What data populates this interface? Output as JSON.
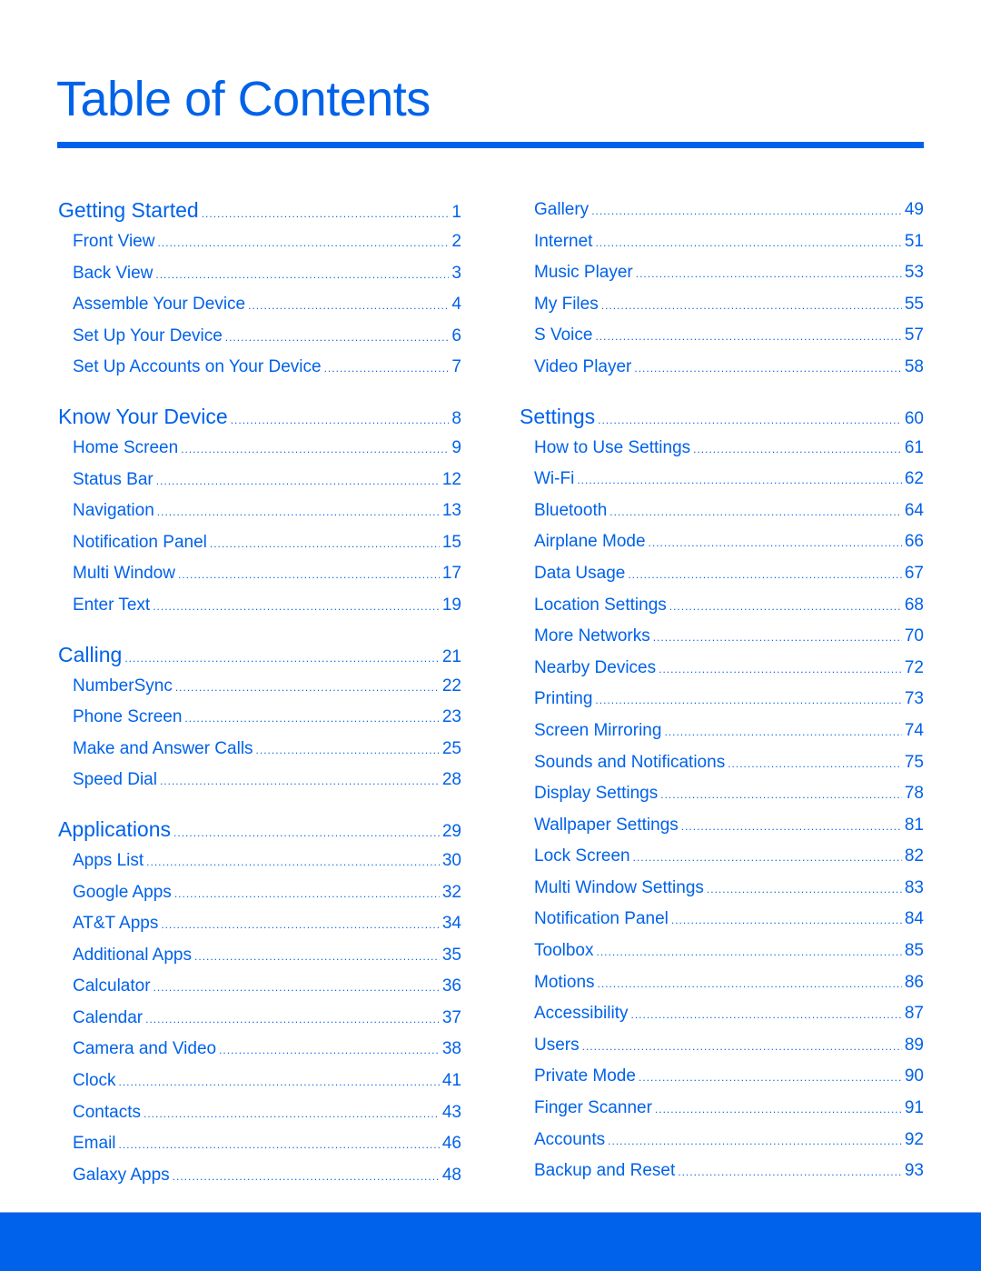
{
  "page": {
    "title": "Table of Contents",
    "accent_color": "#0062ea"
  },
  "toc": {
    "left": [
      {
        "title": "Getting Started",
        "page": "1",
        "items": [
          {
            "label": "Front View",
            "page": "2"
          },
          {
            "label": "Back View",
            "page": "3"
          },
          {
            "label": "Assemble Your Device",
            "page": "4"
          },
          {
            "label": "Set Up Your Device",
            "page": "6"
          },
          {
            "label": "Set Up Accounts on Your Device",
            "page": "7"
          }
        ]
      },
      {
        "title": "Know Your Device",
        "page": "8",
        "items": [
          {
            "label": "Home Screen",
            "page": "9"
          },
          {
            "label": "Status Bar",
            "page": "12"
          },
          {
            "label": "Navigation",
            "page": "13"
          },
          {
            "label": "Notification Panel",
            "page": "15"
          },
          {
            "label": "Multi Window",
            "page": "17"
          },
          {
            "label": "Enter Text",
            "page": "19"
          }
        ]
      },
      {
        "title": "Calling",
        "page": "21",
        "items": [
          {
            "label": "NumberSync",
            "page": "22"
          },
          {
            "label": "Phone Screen",
            "page": "23"
          },
          {
            "label": "Make and Answer Calls",
            "page": "25"
          },
          {
            "label": "Speed Dial",
            "page": "28"
          }
        ]
      },
      {
        "title": "Applications",
        "page": "29",
        "items": [
          {
            "label": "Apps List",
            "page": "30"
          },
          {
            "label": "Google Apps",
            "page": "32"
          },
          {
            "label": "AT&T Apps",
            "page": "34"
          },
          {
            "label": "Additional Apps",
            "page": "35"
          },
          {
            "label": "Calculator",
            "page": "36"
          },
          {
            "label": "Calendar",
            "page": "37"
          },
          {
            "label": "Camera and Video",
            "page": "38"
          },
          {
            "label": "Clock",
            "page": "41"
          },
          {
            "label": "Contacts",
            "page": "43"
          },
          {
            "label": "Email",
            "page": "46"
          },
          {
            "label": "Galaxy Apps",
            "page": "48"
          }
        ]
      }
    ],
    "right_continued": [
      {
        "label": "Gallery",
        "page": "49"
      },
      {
        "label": "Internet",
        "page": "51"
      },
      {
        "label": "Music Player",
        "page": "53"
      },
      {
        "label": "My Files",
        "page": "55"
      },
      {
        "label": "S Voice",
        "page": "57"
      },
      {
        "label": "Video Player",
        "page": "58"
      }
    ],
    "right": [
      {
        "title": "Settings",
        "page": "60",
        "items": [
          {
            "label": "How to Use Settings",
            "page": "61"
          },
          {
            "label": "Wi-Fi",
            "page": "62"
          },
          {
            "label": "Bluetooth",
            "page": "64"
          },
          {
            "label": "Airplane Mode",
            "page": "66"
          },
          {
            "label": "Data Usage",
            "page": "67"
          },
          {
            "label": "Location Settings",
            "page": "68"
          },
          {
            "label": "More Networks",
            "page": "70"
          },
          {
            "label": "Nearby Devices",
            "page": "72"
          },
          {
            "label": "Printing",
            "page": "73"
          },
          {
            "label": "Screen Mirroring",
            "page": "74"
          },
          {
            "label": "Sounds and Notifications",
            "page": "75"
          },
          {
            "label": "Display Settings",
            "page": "78"
          },
          {
            "label": "Wallpaper Settings",
            "page": "81"
          },
          {
            "label": "Lock Screen",
            "page": "82"
          },
          {
            "label": "Multi Window Settings",
            "page": "83"
          },
          {
            "label": "Notification Panel",
            "page": "84"
          },
          {
            "label": "Toolbox",
            "page": "85"
          },
          {
            "label": "Motions",
            "page": "86"
          },
          {
            "label": "Accessibility",
            "page": "87"
          },
          {
            "label": "Users",
            "page": "89"
          },
          {
            "label": "Private Mode",
            "page": "90"
          },
          {
            "label": "Finger Scanner",
            "page": "91"
          },
          {
            "label": "Accounts",
            "page": "92"
          },
          {
            "label": "Backup and Reset",
            "page": "93"
          }
        ]
      }
    ]
  }
}
